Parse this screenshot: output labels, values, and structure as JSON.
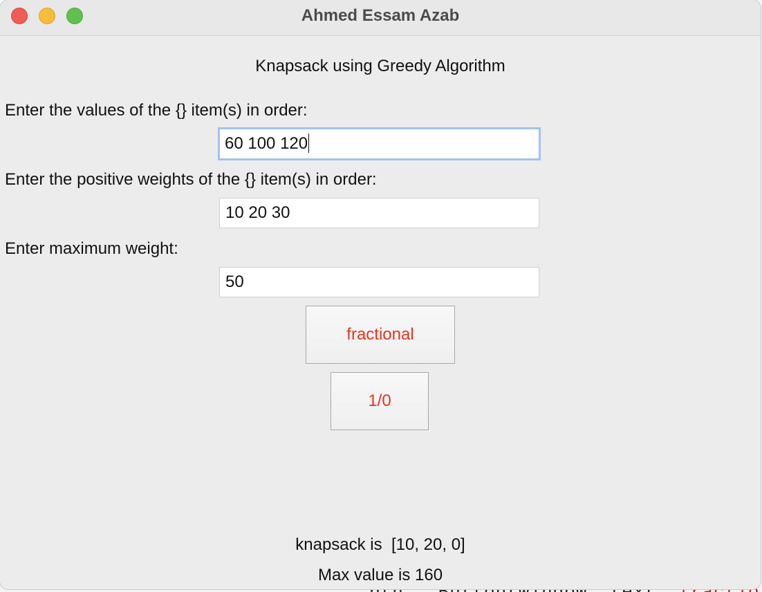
{
  "window": {
    "title": "Ahmed Essam Azab"
  },
  "app": {
    "heading": "Knapsack using Greedy Algorithm",
    "values_prompt": "Enter the values of the {} item(s) in order:",
    "values_value": "60 100 120",
    "weights_prompt": "Enter the positive weights of the {} item(s) in order:",
    "weights_value": "10 20 30",
    "max_weight_prompt": "Enter maximum weight:",
    "max_weight_value": "50",
    "fractional_button": "fractional",
    "zero_one_button": "1/0",
    "knapsack_result": "knapsack is  [10, 20, 0]",
    "max_value_result": "Max value is 160"
  },
  "colors": {
    "button_text": "#e8331f",
    "focus_ring": "#a3c2ec"
  },
  "backdrop": {
    "code_a": "btn ",
    "code_b": "= ",
    "code_c": "Button(window, text",
    "code_d": "= ",
    "code_e": "fractio"
  }
}
